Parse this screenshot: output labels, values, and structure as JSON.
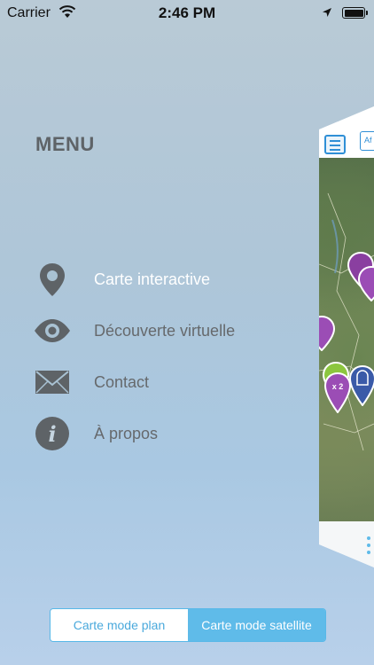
{
  "status_bar": {
    "carrier": "Carrier",
    "time": "2:46 PM"
  },
  "menu": {
    "title": "MENU",
    "items": [
      {
        "label": "Carte interactive",
        "icon": "location-pin-icon",
        "active": true
      },
      {
        "label": "Découverte virtuelle",
        "icon": "eye-icon",
        "active": false
      },
      {
        "label": "Contact",
        "icon": "envelope-icon",
        "active": false
      },
      {
        "label": "À propos",
        "icon": "info-icon",
        "active": false
      }
    ]
  },
  "map_preview": {
    "button_partial": "Af",
    "cluster_badge": "x 2"
  },
  "map_mode": {
    "plan_label": "Carte mode plan",
    "satellite_label": "Carte mode satellite",
    "selected": "satellite"
  },
  "colors": {
    "accent": "#5fbbe9",
    "menu_text": "#66696c",
    "menu_active_text": "#ffffff",
    "icon": "#5e6367"
  }
}
